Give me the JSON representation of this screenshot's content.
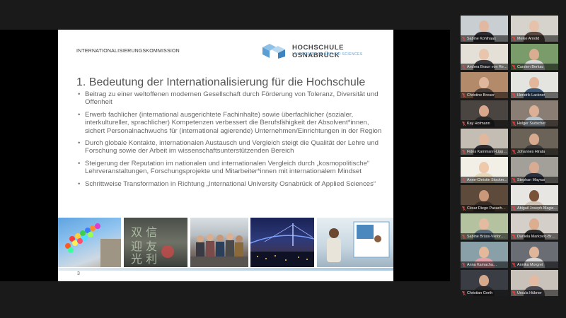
{
  "slide": {
    "header_label": "INTERNATIONALISIERUNGSKOMMISSION",
    "logo_name": "HOCHSCHULE OSNABRÜCK",
    "logo_sub": "UNIVERSITY OF APPLIED SCIENCES",
    "title": "1. Bedeutung der Internationalisierung für die Hochschule",
    "bullets": [
      "Beitrag zu einer weltoffenen modernen Gesellschaft durch Förderung von Toleranz, Diversität und Offenheit",
      "Erwerb fachlicher (international ausgerichtete Fachinhalte) sowie überfachlicher (sozialer, interkultureller, sprachlicher) Kompetenzen verbessert die Berufsfähigkeit der Absolvent*innen, sichert Personalnachwuchs für (international agierende) Unternehmen/Einrichtungen in der Region",
      "Durch globale Kontakte, internationalen Austausch und Vergleich steigt die Qualität der Lehre und Forschung sowie der Arbeit im wissenschaftsunterstützenden Bereich",
      "Steigerung der Reputation im nationalen und internationalen Vergleich durch „kosmopolitische“ Lehrveranstaltungen, Forschungsprojekte und Mitarbeiter*innen mit internationalem Mindset",
      "Schrittweise Transformation in Richtung „International University Osnabrück of Applied Sciences“"
    ],
    "page_number": "3"
  },
  "participants": [
    {
      "name": "Sabine Kohlhaas",
      "bg": "#c9ced3",
      "skin": "#e2b9a0",
      "shirt": "#2d2d33",
      "active": false
    },
    {
      "name": "Meike Arnold",
      "bg": "#d6d2cc",
      "skin": "#e6c2aa",
      "shirt": "#5a4a42",
      "active": false
    },
    {
      "name": "Andrea Braun von Reine…",
      "bg": "#e4e0d8",
      "skin": "#e8c5ad",
      "shirt": "#3d3a40",
      "active": true
    },
    {
      "name": "Carsten Berkau",
      "bg": "#7a9b6a",
      "skin": "#d9ad92",
      "shirt": "#d8d8d8",
      "active": false
    },
    {
      "name": "Christine Breuer",
      "bg": "#b38a6a",
      "skin": "#e0b79d",
      "shirt": "#4a3e38",
      "active": false
    },
    {
      "name": "Hendrik Lackner",
      "bg": "#e4e4e0",
      "skin": "#e2b79c",
      "shirt": "#3e5a7a",
      "active": false
    },
    {
      "name": "Kay Hofmann",
      "bg": "#4a4540",
      "skin": "#d9a88c",
      "shirt": "#2a2a2a",
      "active": false
    },
    {
      "name": "Holger Sudschet",
      "bg": "#8a7e74",
      "skin": "#dcb095",
      "shirt": "#b8c4cc",
      "active": false
    },
    {
      "name": "Fides Kammann-Lipp…",
      "bg": "#c4bdb4",
      "skin": "#e1b89e",
      "shirt": "#2e2a30",
      "active": false
    },
    {
      "name": "Johannes Hirata",
      "bg": "#6b6258",
      "skin": "#d9ab8e",
      "shirt": "#3a3a3a",
      "active": false
    },
    {
      "name": "Anne-Christin Stockm…",
      "bg": "#f2efe6",
      "skin": "#efc9ac",
      "shirt": "#e6d8b8",
      "active": false
    },
    {
      "name": "Stephan Mayrus",
      "bg": "#a3a09a",
      "skin": "#d8ac92",
      "shirt": "#2b3342",
      "active": false
    },
    {
      "name": "César Diego Pasach…",
      "bg": "#5e4a3a",
      "skin": "#c99779",
      "shirt": "#3a2f28",
      "active": false
    },
    {
      "name": "Abigail Joseph-Magie…",
      "bg": "#e8e6e2",
      "skin": "#7a5238",
      "shirt": "#d1c4b4",
      "active": false
    },
    {
      "name": "Sabine Brüss-Viefor…",
      "bg": "#b4c2a0",
      "skin": "#e4bba0",
      "shirt": "#5a6a7a",
      "active": false
    },
    {
      "name": "Daniela Markovic-Br…",
      "bg": "#d4cfc9",
      "skin": "#dcae90",
      "shirt": "#2f2f2f",
      "active": false
    },
    {
      "name": "Anna Kamacha…",
      "bg": "#8aa0a8",
      "skin": "#e3b89b",
      "shirt": "#e6a0a8",
      "active": false
    },
    {
      "name": "Annika Morgret",
      "bg": "#6a6e74",
      "skin": "#e0b69b",
      "shirt": "#d8d8d8",
      "active": false
    },
    {
      "name": "Christian Gerth",
      "bg": "#3a3e44",
      "skin": "#d6a98d",
      "shirt": "#2a2a2e",
      "active": false
    },
    {
      "name": "Ursula Hübner",
      "bg": "#c8c2ba",
      "skin": "#e2bba2",
      "shirt": "#4c4a52",
      "active": false
    }
  ],
  "colors": {
    "mic_muted": "#e04646",
    "active_speaker": "#d7e34a",
    "logo_blue": "#5a9fd4"
  }
}
